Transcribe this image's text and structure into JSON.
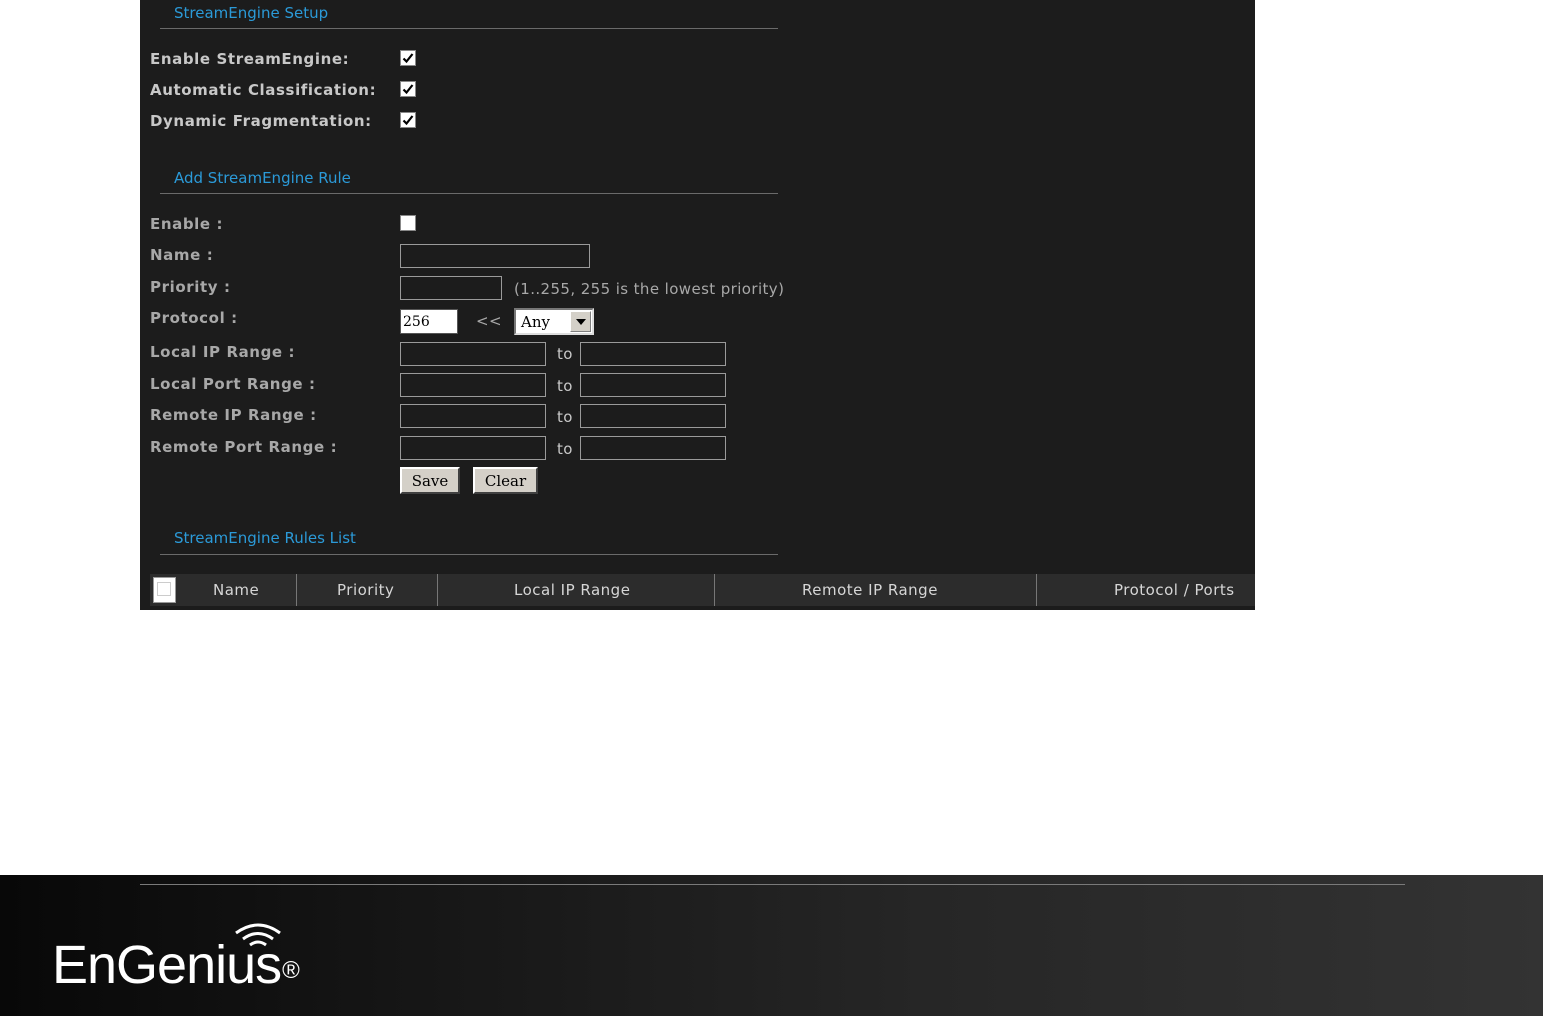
{
  "setup": {
    "title": "StreamEngine Setup",
    "enable_label": "Enable StreamEngine:",
    "enable_checked": true,
    "auto_class_label": "Automatic Classification:",
    "auto_class_checked": true,
    "dyn_frag_label": "Dynamic Fragmentation:",
    "dyn_frag_checked": true
  },
  "rule": {
    "title": "Add StreamEngine Rule",
    "enable_label": "Enable :",
    "enable_checked": false,
    "name_label": "Name :",
    "name_value": "",
    "priority_label": "Priority :",
    "priority_value": "",
    "priority_hint": "(1..255, 255 is the lowest priority)",
    "protocol_label": "Protocol :",
    "protocol_value": "256",
    "protocol_arrow": "<<",
    "protocol_select": "Any",
    "local_ip_label": "Local IP Range :",
    "local_port_label": "Local Port Range :",
    "remote_ip_label": "Remote IP Range :",
    "remote_port_label": "Remote Port Range :",
    "to": "to",
    "save_label": "Save",
    "clear_label": "Clear"
  },
  "rules_list": {
    "title": "StreamEngine Rules List",
    "columns": [
      "Name",
      "Priority",
      "Local IP Range",
      "Remote IP Range",
      "Protocol / Ports"
    ]
  },
  "footer": {
    "logo_text": "EnGenius",
    "logo_mark": "®"
  },
  "colors": {
    "panel_bg": "#1c1c1c",
    "section_title": "#2b9ad8",
    "label": "#c8c8c8"
  }
}
